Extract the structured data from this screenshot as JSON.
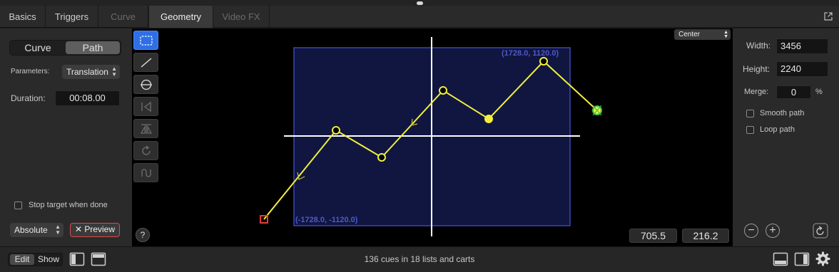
{
  "tabs": [
    {
      "label": "Basics",
      "state": "normal"
    },
    {
      "label": "Triggers",
      "state": "normal"
    },
    {
      "label": "Curve",
      "state": "disabled"
    },
    {
      "label": "Geometry",
      "state": "active"
    },
    {
      "label": "Video FX",
      "state": "disabled"
    }
  ],
  "left": {
    "mode_curve": "Curve",
    "mode_path": "Path",
    "parameters_label": "Parameters:",
    "parameters_value": "Translation",
    "duration_label": "Duration:",
    "duration_value": "00:08.00",
    "stop_target_label": "Stop target when done",
    "absolute_value": "Absolute",
    "preview_label": "✕ Preview"
  },
  "canvas": {
    "anchor_value": "Center",
    "top_right_label": "(1728.0, 1120.0)",
    "bottom_left_label": "(-1728.0, -1120.0)",
    "coord_x": "705.5",
    "coord_y": "216.2",
    "help_label": "?",
    "path_color": "#f2ef3c",
    "frame_fill": "#101640",
    "frame_stroke": "#3a45b8"
  },
  "right": {
    "width_label": "Width:",
    "width_value": "3456",
    "height_label": "Height:",
    "height_value": "2240",
    "merge_label": "Merge:",
    "merge_value": "0",
    "merge_unit": "%",
    "smooth_label": "Smooth path",
    "loop_label": "Loop path"
  },
  "bottom": {
    "edit_label": "Edit",
    "show_label": "Show",
    "status_text": "136 cues in 18 lists and carts"
  }
}
